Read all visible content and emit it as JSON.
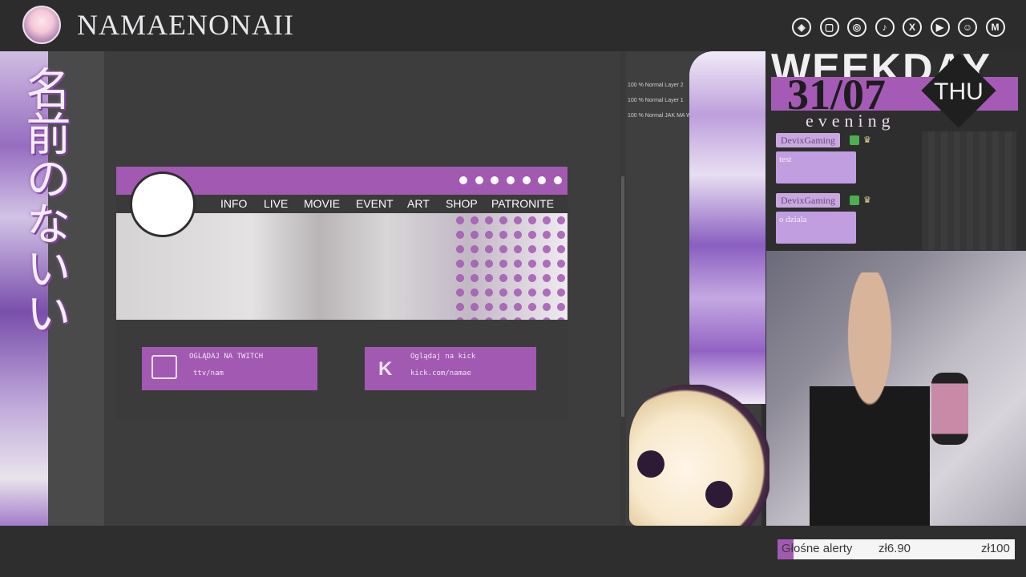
{
  "header": {
    "channel_name": "NAMAENONAII",
    "socials": [
      {
        "icon": "streamlabs-icon",
        "glyph": "◈"
      },
      {
        "icon": "twitch-icon",
        "glyph": "▢"
      },
      {
        "icon": "instagram-icon",
        "glyph": "◎"
      },
      {
        "icon": "tiktok-icon",
        "glyph": "♪"
      },
      {
        "icon": "x-icon",
        "glyph": "X"
      },
      {
        "icon": "youtube-icon",
        "glyph": "▶"
      },
      {
        "icon": "discord-icon",
        "glyph": "☺"
      },
      {
        "icon": "mail-icon",
        "glyph": "M"
      }
    ]
  },
  "overlay": {
    "japanese_title": "名前のないい",
    "weekday": "WEEKDAY",
    "date": "31/07",
    "day": "THU",
    "time_of_day": "evening"
  },
  "mockup": {
    "nav": [
      "INFO",
      "LIVE",
      "MOVIE",
      "EVENT",
      "ART",
      "SHOP",
      "PATRONITE"
    ],
    "promo_twitch_line1": "OGLĄDAJ NA TWITCH",
    "promo_twitch_line2": "ttv/nam",
    "promo_kick_line1": "Oglądaj na kick",
    "promo_kick_line2": "kick.com/namae"
  },
  "layers": [
    {
      "label": "100 % Normal Layer 2"
    },
    {
      "label": "100 % Normal Layer 1"
    },
    {
      "label": "100 % Normal JAK MA WYGL"
    }
  ],
  "chat": [
    {
      "user": "DevixGaming",
      "message": "test"
    },
    {
      "user": "DevixGaming",
      "message": "o dziala"
    }
  ],
  "alerts": {
    "label": "Głośne alerty",
    "current": "zł6.90",
    "goal": "zł100",
    "progress": 0.069
  },
  "colors": {
    "accent": "#a259b2",
    "background": "#2e2e2e"
  }
}
